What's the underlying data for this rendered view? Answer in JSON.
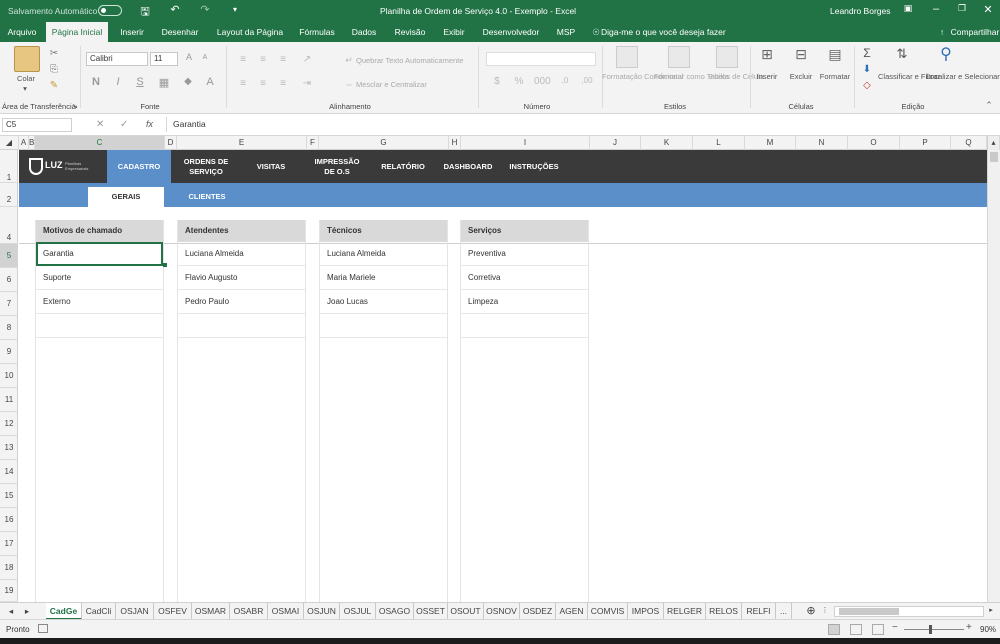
{
  "titlebar": {
    "autosave_label": "Salvamento Automático",
    "title": "Planilha de Ordem de Serviço 4.0 - Exemplo  -  Excel",
    "user": "Leandro Borges"
  },
  "menu": {
    "tabs": [
      "Arquivo",
      "Página Inicial",
      "Inserir",
      "Desenhar",
      "Layout da Página",
      "Fórmulas",
      "Dados",
      "Revisão",
      "Exibir",
      "Desenvolvedor",
      "MSP"
    ],
    "active": "Página Inicial",
    "tell_me": "Diga-me o que você deseja fazer",
    "share": "Compartilhar"
  },
  "ribbon": {
    "clipboard": {
      "paste": "Colar",
      "group": "Área de Transferência"
    },
    "font": {
      "name": "Calibri",
      "size": "11",
      "bold": "N",
      "italic": "I",
      "underline": "S",
      "group": "Fonte"
    },
    "alignment": {
      "wrap": "Quebrar Texto Automaticamente",
      "merge": "Mesclar e Centralizar",
      "group": "Alinhamento"
    },
    "number": {
      "group": "Número"
    },
    "styles": {
      "conditional": "Formatação Condicional",
      "table": "Formatar como Tabela",
      "cell": "Estilos de Célula",
      "group": "Estilos"
    },
    "cells": {
      "insert": "Inserir",
      "delete": "Excluir",
      "format": "Formatar",
      "group": "Células"
    },
    "editing": {
      "sort": "Classificar e Filtrar",
      "find": "Localizar e Selecionar",
      "group": "Edição"
    }
  },
  "formula_bar": {
    "name_box": "C5",
    "fx": "fx",
    "value": "Garantia"
  },
  "columns": [
    "A",
    "B",
    "C",
    "D",
    "E",
    "F",
    "G",
    "H",
    "I",
    "J",
    "K",
    "L",
    "M",
    "N",
    "O",
    "P",
    "Q"
  ],
  "rows": [
    "1",
    "2",
    "4",
    "5",
    "6",
    "7",
    "8",
    "9",
    "10",
    "11",
    "12",
    "13",
    "14",
    "15",
    "16",
    "17",
    "18",
    "19"
  ],
  "sheet": {
    "logo": "LUZ",
    "logo_sub": "Planilhas Empresariais",
    "nav": [
      "CADASTRO",
      "ORDENS DE SERVIÇO",
      "VISITAS",
      "IMPRESSÃO DE O.S",
      "RELATÓRIO",
      "DASHBOARD",
      "INSTRUÇÕES"
    ],
    "subtabs": [
      "GERAIS",
      "CLIENTES"
    ],
    "lists": [
      {
        "header": "Motivos de chamado",
        "items": [
          "Garantia",
          "Suporte",
          "Externo"
        ]
      },
      {
        "header": "Atendentes",
        "items": [
          "Luciana Almeida",
          "Flavio Augusto",
          "Pedro Paulo"
        ]
      },
      {
        "header": "Técnicos",
        "items": [
          "Luciana Almeida",
          "Maria Mariele",
          "Joao Lucas"
        ]
      },
      {
        "header": "Serviços",
        "items": [
          "Preventiva",
          "Corretiva",
          "Limpeza"
        ]
      }
    ]
  },
  "sheet_tabs": [
    "CadGe",
    "CadCli",
    "OSJAN",
    "OSFEV",
    "OSMAR",
    "OSABR",
    "OSMAI",
    "OSJUN",
    "OSJUL",
    "OSAGO",
    "OSSET",
    "OSOUT",
    "OSNOV",
    "OSDEZ",
    "AGEN",
    "COMVIS",
    "IMPOS",
    "RELGER",
    "RELOS",
    "RELFI",
    "..."
  ],
  "active_sheet": "CadGe",
  "status": {
    "ready": "Pronto",
    "zoom": "90%"
  }
}
